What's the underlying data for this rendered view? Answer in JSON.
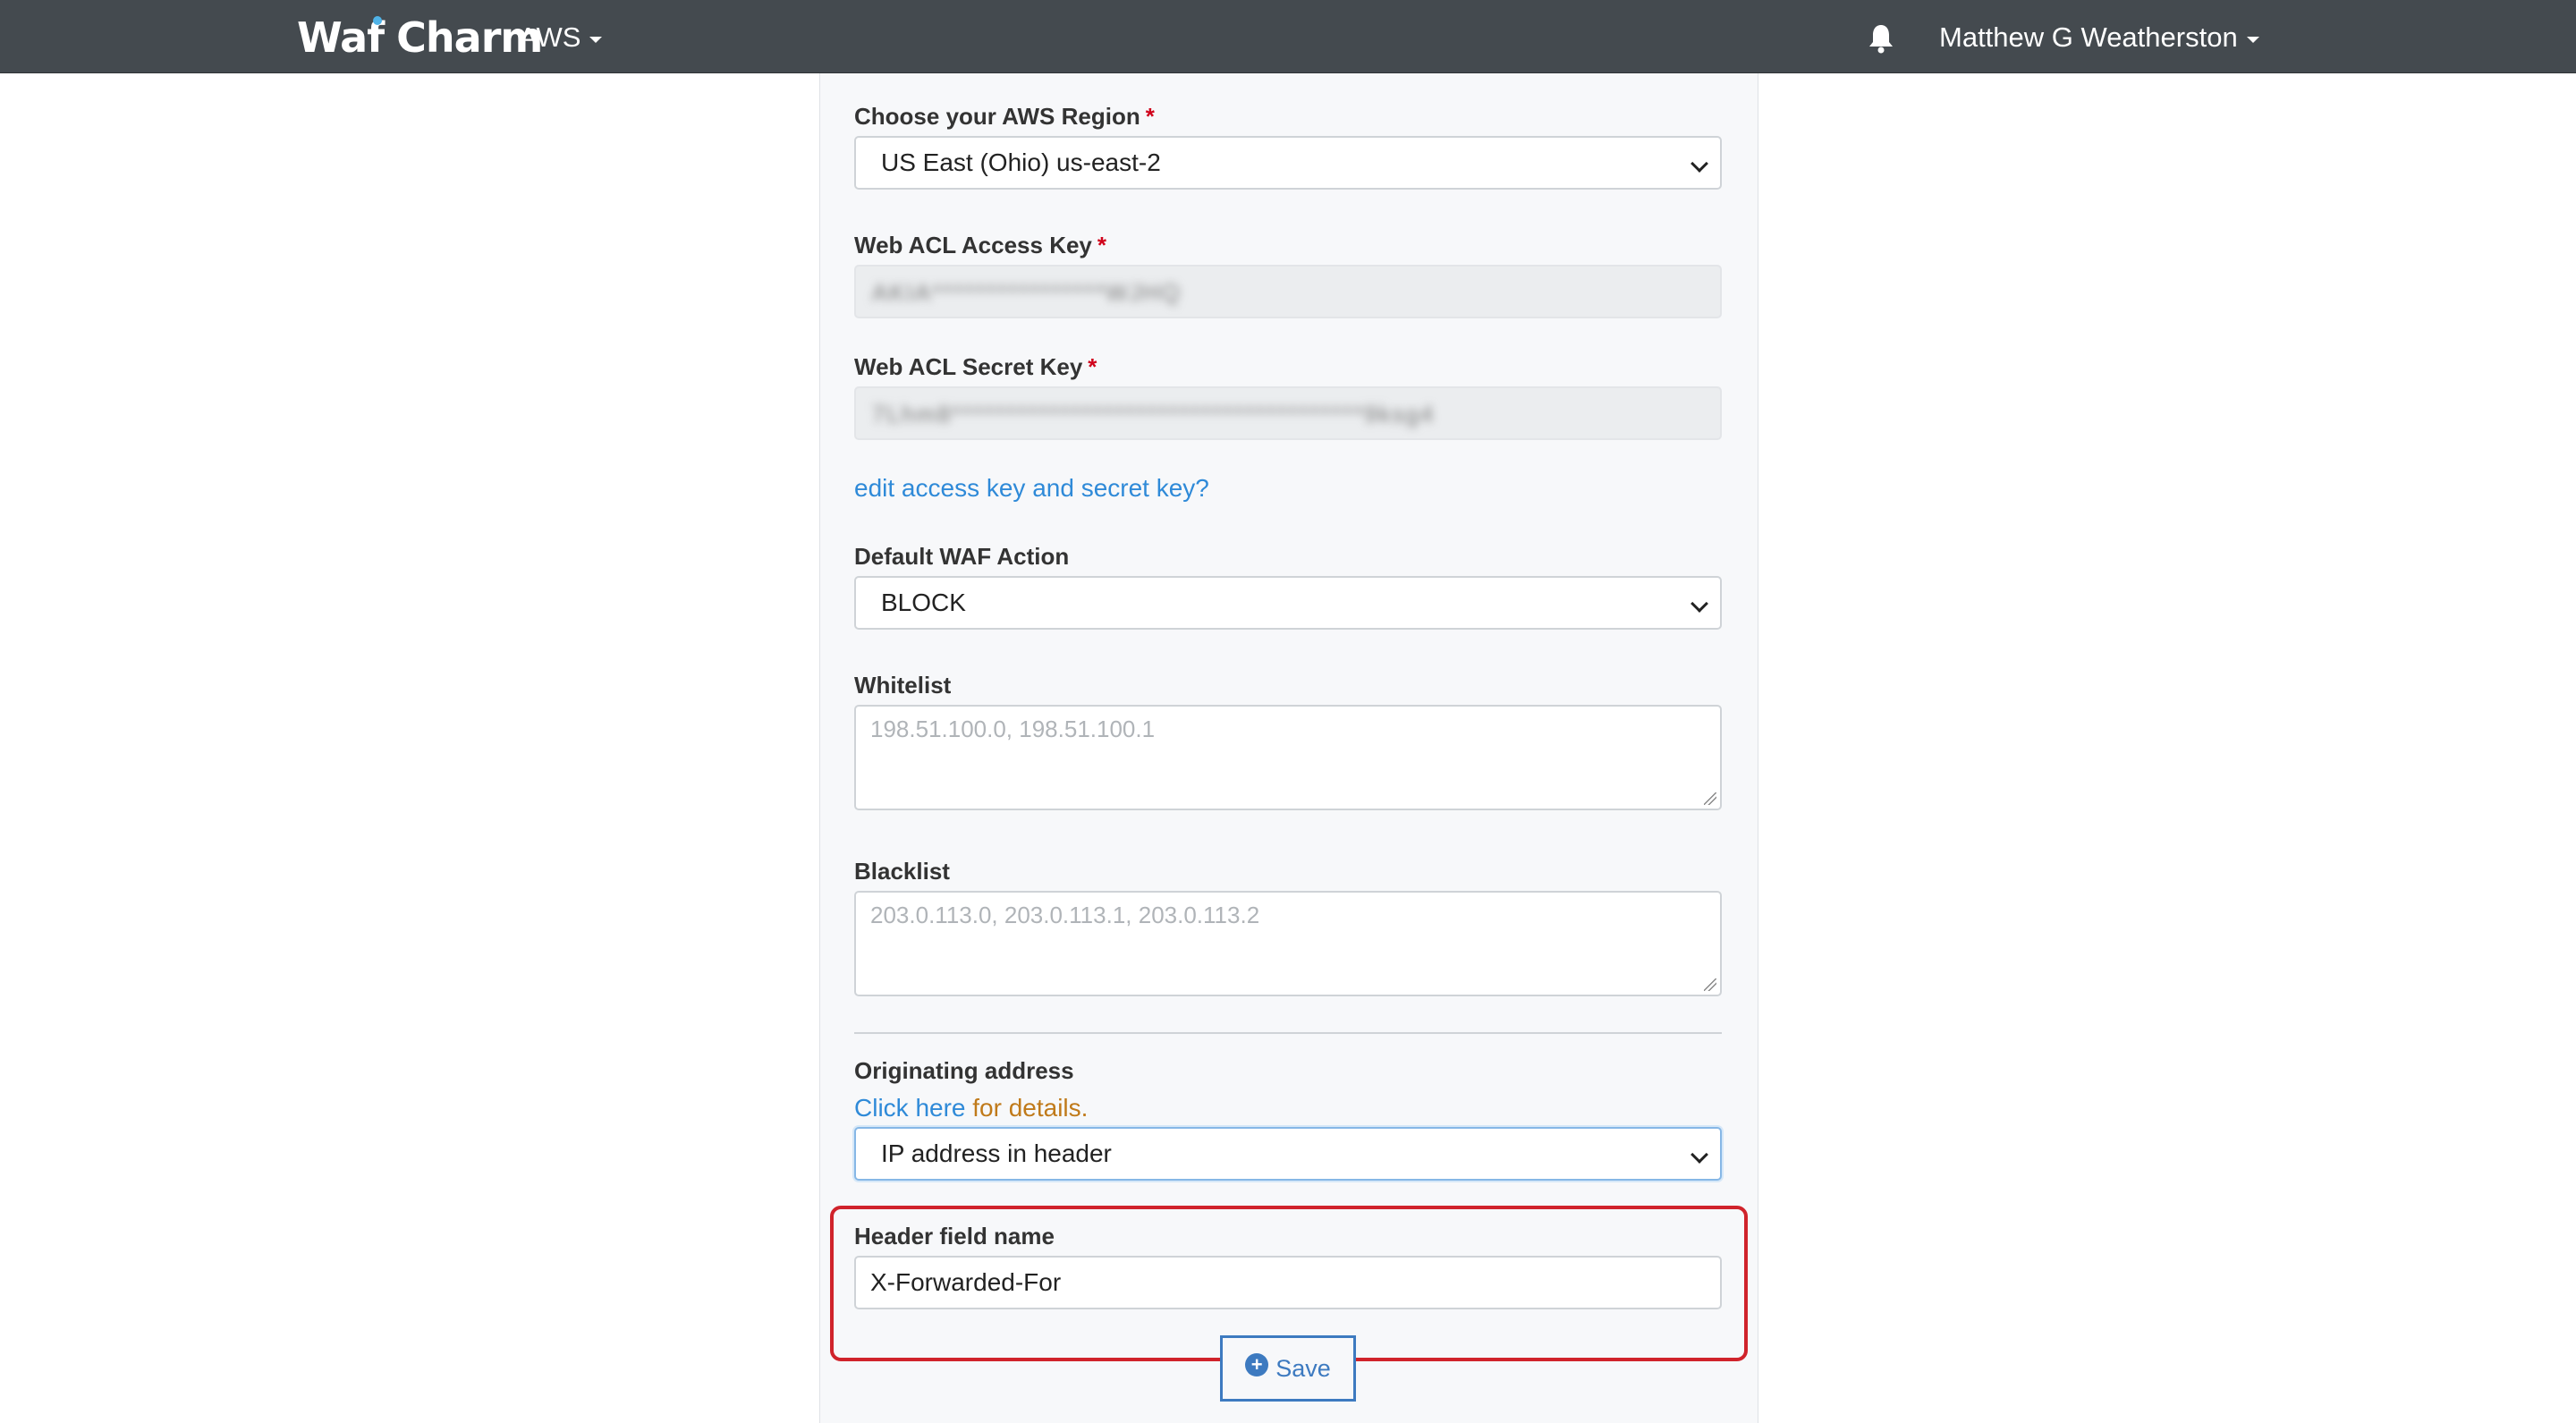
{
  "navbar": {
    "brand_part1": "Waf",
    "brand_part2": "Charm",
    "cloud_menu": "AWS",
    "user_menu": "Matthew G Weatherston",
    "accent_color": "#4fb3e8"
  },
  "form": {
    "region": {
      "label": "Choose your AWS Region",
      "required_mark": "*",
      "value": "US East (Ohio) us-east-2"
    },
    "access_key": {
      "label": "Web ACL Access Key",
      "required_mark": "*",
      "value_masked": "AKIA****************WJHQ"
    },
    "secret_key": {
      "label": "Web ACL Secret Key",
      "required_mark": "*",
      "value_masked": "7Lhm8**************************************9ksg4"
    },
    "edit_keys_link": "edit access key and secret key?",
    "default_action": {
      "label": "Default WAF Action",
      "value": "BLOCK"
    },
    "whitelist": {
      "label": "Whitelist",
      "placeholder": "198.51.100.0, 198.51.100.1"
    },
    "blacklist": {
      "label": "Blacklist",
      "placeholder": "203.0.113.0, 203.0.113.1, 203.0.113.2"
    },
    "originating_address": {
      "label": "Originating address",
      "details_link": "Click here",
      "details_text": " for details.",
      "value": "IP address in header"
    },
    "header_field": {
      "label": "Header field name",
      "value": "X-Forwarded-For"
    },
    "save_label": "Save",
    "highlight_color": "#d0232b"
  }
}
